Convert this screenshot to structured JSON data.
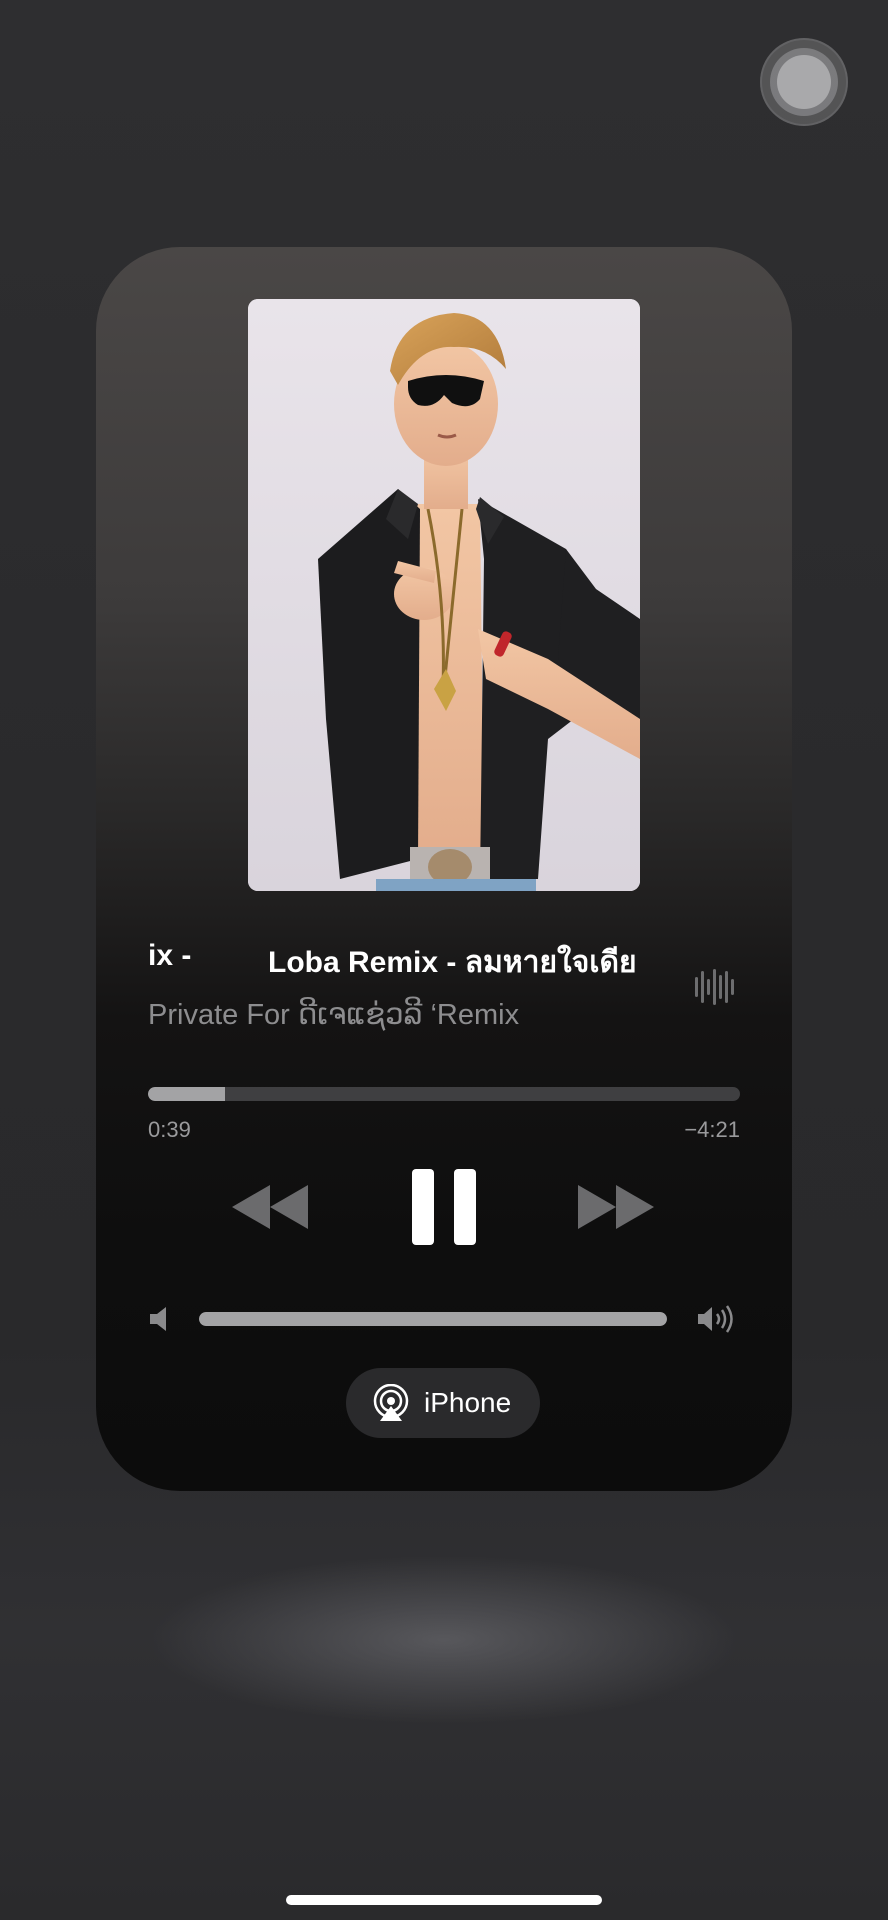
{
  "player": {
    "title_prefix": "ix -",
    "title": "Loba Remix - ลมหายใจเดีย",
    "artist": "Private For ດີເຈແຊ່ວລີ ‘Remix",
    "elapsed": "0:39",
    "remaining": "−4:21",
    "progress_fraction": 0.13,
    "volume_fraction": 1.0,
    "output_device": "iPhone"
  },
  "icons": {
    "assistive_touch": "assistive-touch-icon",
    "waveform": "waveform-icon",
    "rewind": "rewind-icon",
    "pause": "pause-icon",
    "forward": "fast-forward-icon",
    "volume_low": "speaker-low-icon",
    "volume_high": "speaker-high-icon",
    "airplay": "airplay-icon"
  },
  "colors": {
    "accent_text": "#ffffff",
    "secondary_text": "#8d8d8f",
    "track_fill": "#a3a3a5",
    "track_bg": "#3f3f41"
  }
}
